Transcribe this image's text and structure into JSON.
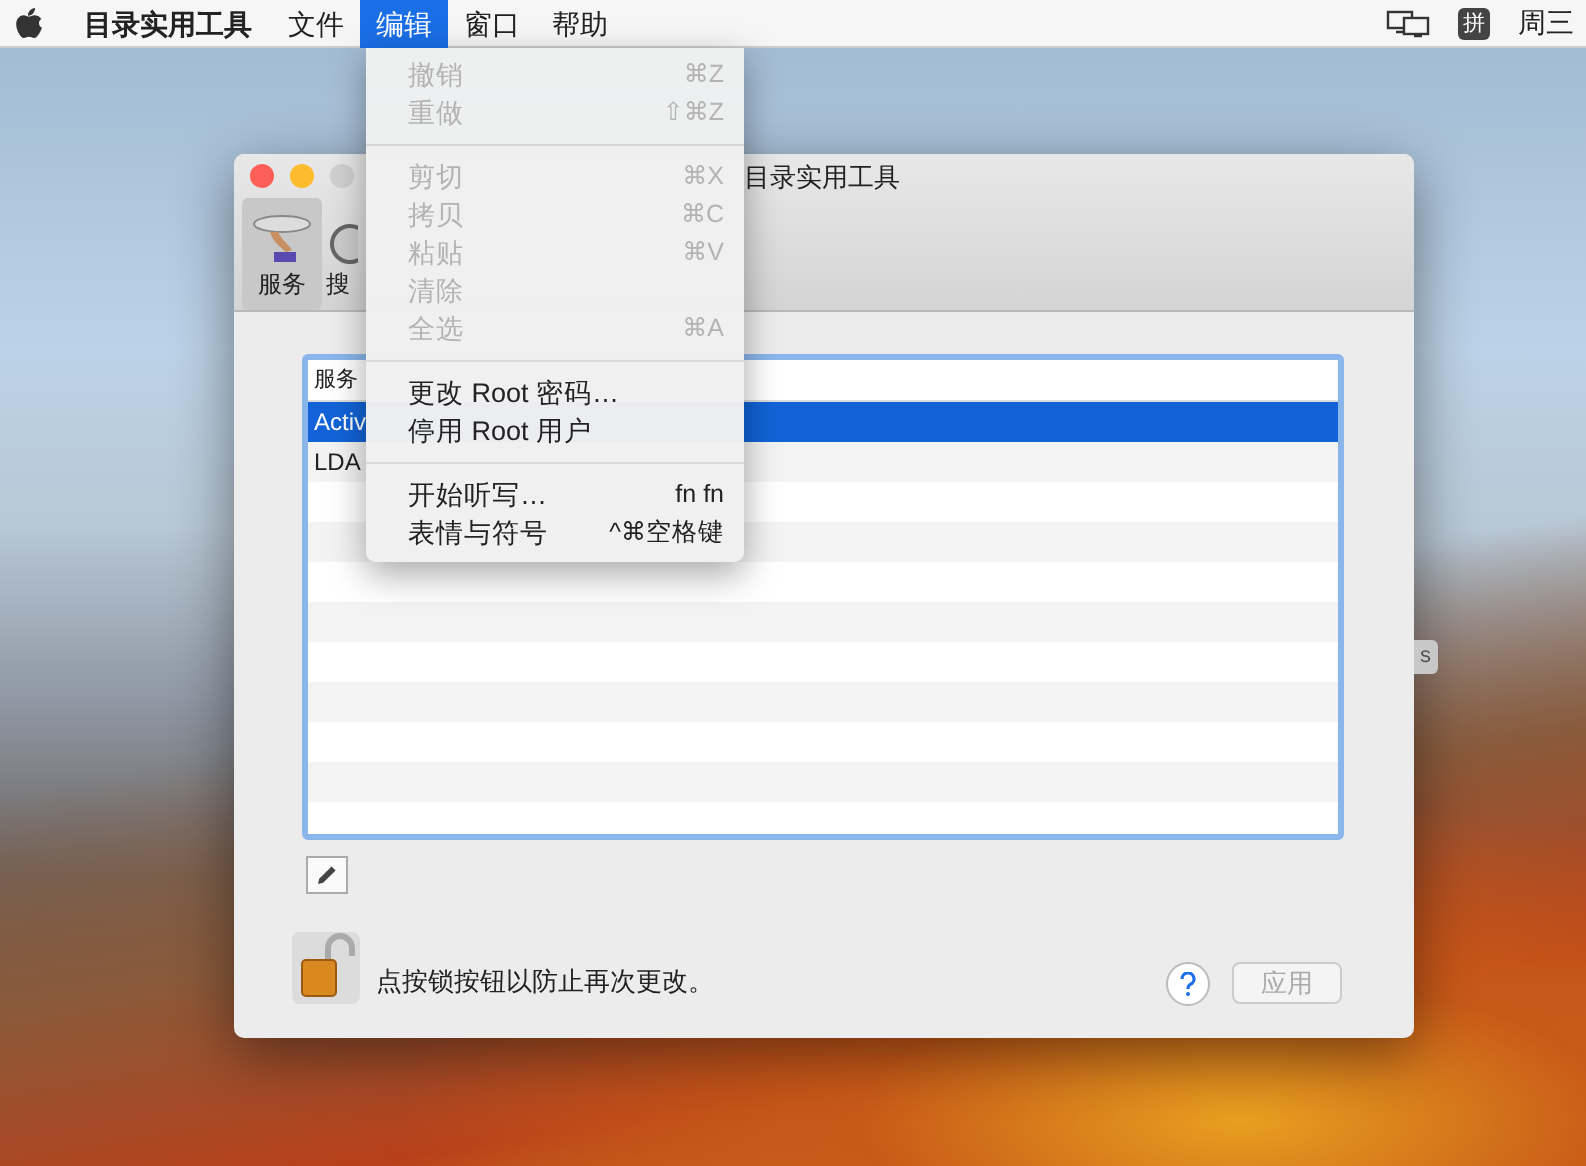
{
  "menubar": {
    "app_name": "目录实用工具",
    "menus": [
      {
        "label": "文件",
        "selected": false
      },
      {
        "label": "编辑",
        "selected": true
      },
      {
        "label": "窗口",
        "selected": false
      },
      {
        "label": "帮助",
        "selected": false
      }
    ],
    "input_method": "拼",
    "clock": "周三"
  },
  "window": {
    "title": "目录实用工具",
    "toolbar": [
      {
        "label": "服务",
        "selected": true
      },
      {
        "label": "搜",
        "selected": false
      }
    ],
    "table": {
      "columns": [
        "服务"
      ],
      "rows": [
        {
          "cells": [
            "Activ"
          ],
          "selected": true
        },
        {
          "cells": [
            "LDA"
          ],
          "selected": false
        }
      ]
    },
    "lock_text": "点按锁按钮以防止再次更改。",
    "apply_button": {
      "label": "应用",
      "disabled": true
    }
  },
  "background_label": "s",
  "edit_menu": {
    "items": [
      {
        "kind": "item",
        "label": "撤销",
        "shortcut": "⌘Z",
        "disabled": true
      },
      {
        "kind": "item",
        "label": "重做",
        "shortcut": "⇧⌘Z",
        "disabled": true
      },
      {
        "kind": "separator"
      },
      {
        "kind": "item",
        "label": "剪切",
        "shortcut": "⌘X",
        "disabled": true
      },
      {
        "kind": "item",
        "label": "拷贝",
        "shortcut": "⌘C",
        "disabled": true
      },
      {
        "kind": "item",
        "label": "粘贴",
        "shortcut": "⌘V",
        "disabled": true
      },
      {
        "kind": "item",
        "label": "清除",
        "disabled": true
      },
      {
        "kind": "item",
        "label": "全选",
        "shortcut": "⌘A",
        "disabled": true
      },
      {
        "kind": "separator"
      },
      {
        "kind": "item",
        "label": "更改 Root 密码…",
        "disabled": false
      },
      {
        "kind": "item",
        "label": "停用 Root 用户",
        "disabled": false
      },
      {
        "kind": "separator"
      },
      {
        "kind": "item",
        "label": "开始听写…",
        "shortcut": "fn fn",
        "disabled": false
      },
      {
        "kind": "item",
        "label": "表情与符号",
        "shortcut": "^⌘空格键",
        "disabled": false
      }
    ]
  }
}
